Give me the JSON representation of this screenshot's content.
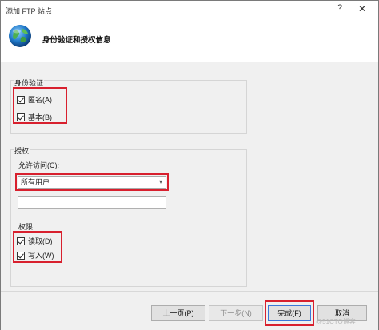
{
  "window": {
    "title": "添加 FTP 站点",
    "help_glyph": "?",
    "close_glyph": "✕"
  },
  "header": {
    "heading": "身份验证和授权信息"
  },
  "authentication": {
    "group_title": "身份验证",
    "anonymous_label": "匿名(A)",
    "anonymous_checked": true,
    "basic_label": "基本(B)",
    "basic_checked": true
  },
  "authorization": {
    "group_title": "授权",
    "allow_access_label": "允许访问(C):",
    "allow_access_value": "所有用户",
    "dropdown_arrow": "▾",
    "user_text": ""
  },
  "permissions": {
    "group_title": "权限",
    "read_label": "读取(D)",
    "read_checked": true,
    "write_label": "写入(W)",
    "write_checked": true
  },
  "buttons": {
    "previous": "上一页(P)",
    "next": "下一步(N)",
    "finish": "完成(F)",
    "cancel": "取消"
  },
  "watermark": "@51CTO博客",
  "colors": {
    "highlight": "#d8202e",
    "panel": "#f0f0f0"
  }
}
